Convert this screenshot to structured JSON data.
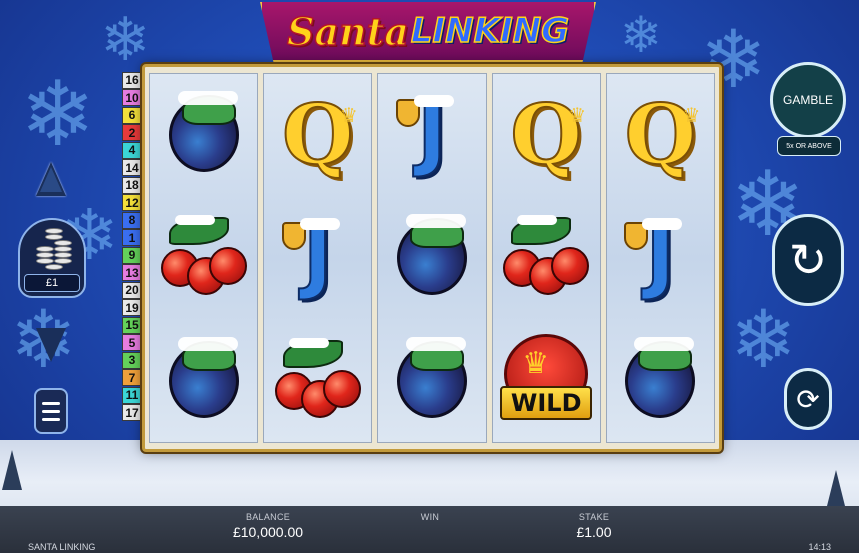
{
  "app": {
    "logo_part1": "Santa",
    "logo_part2": "LINKING",
    "footer_title": "SANTA LINKING",
    "clock": "14:13"
  },
  "paylines": [
    {
      "n": "16",
      "color": "#e9e9e9"
    },
    {
      "n": "10",
      "color": "#e67ce0"
    },
    {
      "n": "6",
      "color": "#f4e03a"
    },
    {
      "n": "2",
      "color": "#e83a3a"
    },
    {
      "n": "4",
      "color": "#3bd6d6"
    },
    {
      "n": "14",
      "color": "#e9e9e9"
    },
    {
      "n": "18",
      "color": "#e9e9e9"
    },
    {
      "n": "12",
      "color": "#f4e03a"
    },
    {
      "n": "8",
      "color": "#3a6ef0"
    },
    {
      "n": "1",
      "color": "#3a6ef0"
    },
    {
      "n": "9",
      "color": "#64d25a"
    },
    {
      "n": "13",
      "color": "#e67ce0"
    },
    {
      "n": "20",
      "color": "#e9e9e9"
    },
    {
      "n": "19",
      "color": "#e9e9e9"
    },
    {
      "n": "15",
      "color": "#64d25a"
    },
    {
      "n": "5",
      "color": "#e67ce0"
    },
    {
      "n": "3",
      "color": "#64d25a"
    },
    {
      "n": "7",
      "color": "#f0a03a"
    },
    {
      "n": "11",
      "color": "#3bd6d6"
    },
    {
      "n": "17",
      "color": "#e9e9e9"
    }
  ],
  "reels": [
    [
      "plum",
      "cherries",
      "plum"
    ],
    [
      "queen",
      "jack",
      "cherries"
    ],
    [
      "jack",
      "plum",
      "plum"
    ],
    [
      "queen",
      "cherries",
      "wild"
    ],
    [
      "queen",
      "jack",
      "plum"
    ]
  ],
  "symbols": {
    "queen": "Q",
    "jack": "J",
    "wild": "WILD"
  },
  "controls": {
    "coin_value": "£1",
    "gamble_label": "GAMBLE",
    "gamble_sub": "5x OR ABOVE",
    "spin_icon": "rotate-arrow-icon",
    "autoplay_icon": "refresh-icon"
  },
  "status": {
    "balance_label": "BALANCE",
    "balance_value": "£10,000.00",
    "win_label": "WIN",
    "win_value": "",
    "stake_label": "STAKE",
    "stake_value": "£1.00"
  },
  "colors": {
    "accent": "#f5c542",
    "frame": "#c29a3b",
    "background": "#1f4bb4"
  }
}
